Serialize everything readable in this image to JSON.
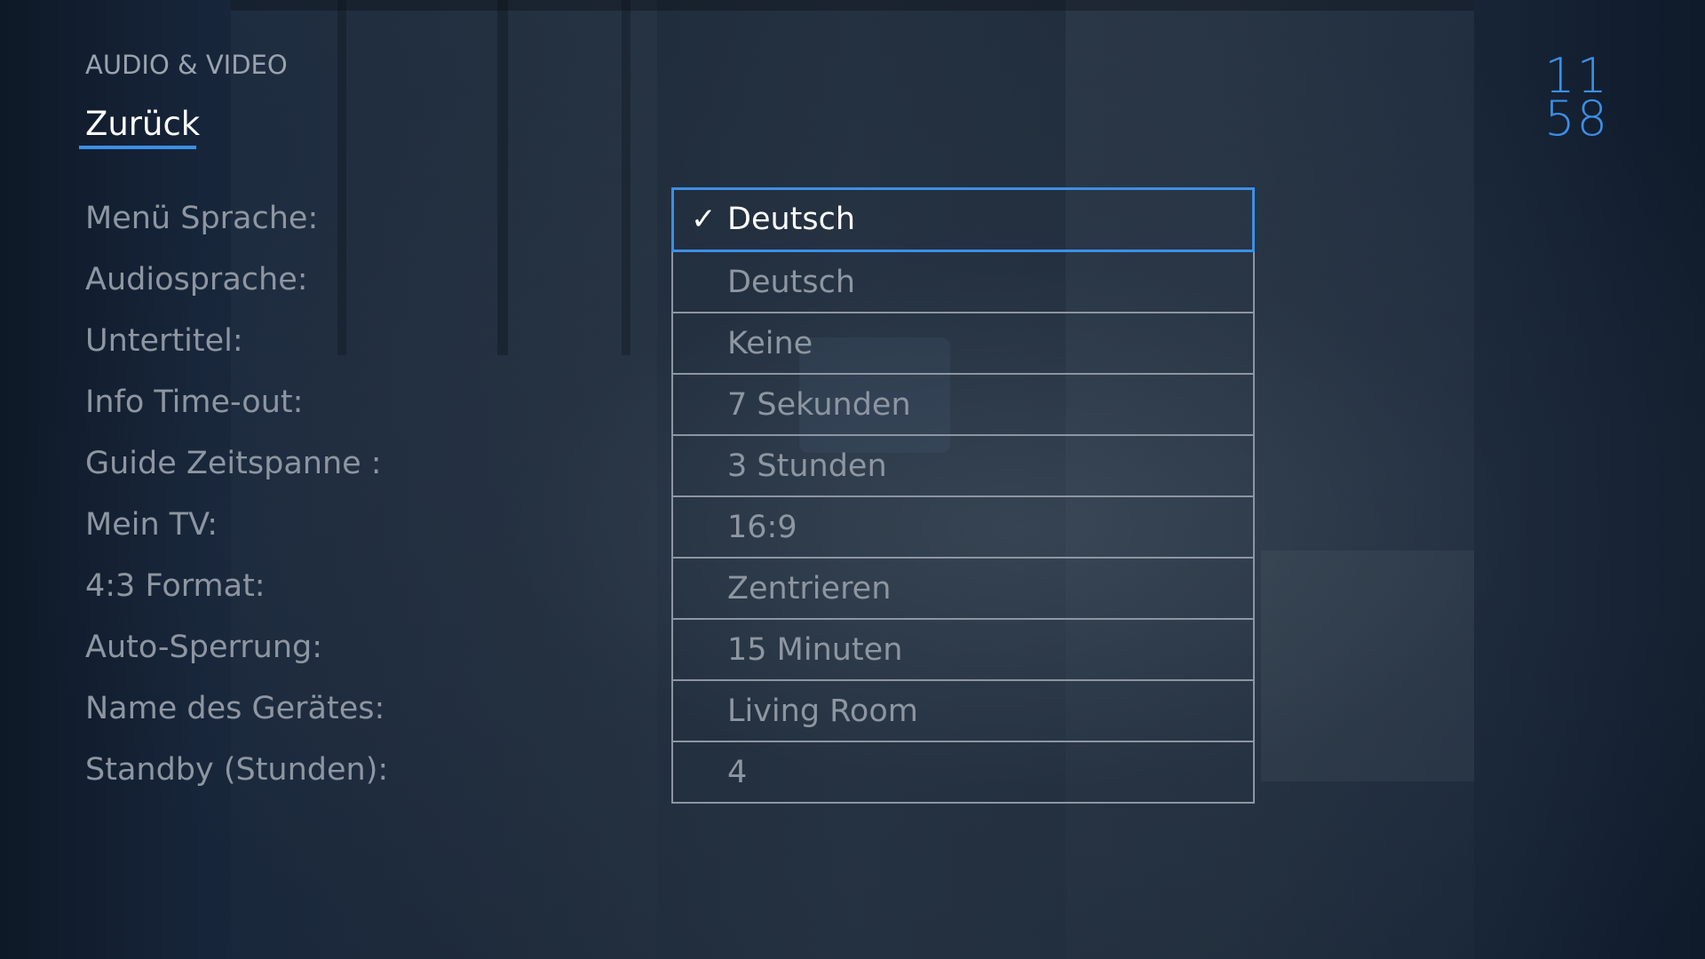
{
  "header": {
    "section_title": "AUDIO & VIDEO",
    "back_label": "Zurück"
  },
  "clock": {
    "hours": "11",
    "minutes": "58"
  },
  "colors": {
    "accent": "#3d8fe6",
    "label_text": "#8d96a1",
    "selected_text": "#ffffff",
    "background": "#0f1a28"
  },
  "settings": [
    {
      "label": "Menü Sprache:",
      "value": "Deutsch",
      "selected": true
    },
    {
      "label": "Audiosprache:",
      "value": "Deutsch"
    },
    {
      "label": "Untertitel:",
      "value": "Keine"
    },
    {
      "label": "Info Time-out:",
      "value": "7 Sekunden"
    },
    {
      "label": "Guide Zeitspanne :",
      "value": "3 Stunden"
    },
    {
      "label": "Mein TV:",
      "value": "16:9"
    },
    {
      "label": "4:3 Format:",
      "value": "Zentrieren"
    },
    {
      "label": "Auto-Sperrung:",
      "value": "15 Minuten"
    },
    {
      "label": "Name des Gerätes:",
      "value": "Living Room"
    },
    {
      "label": "Standby (Stunden):",
      "value": "4"
    }
  ],
  "icons": {
    "check": "check-icon"
  }
}
